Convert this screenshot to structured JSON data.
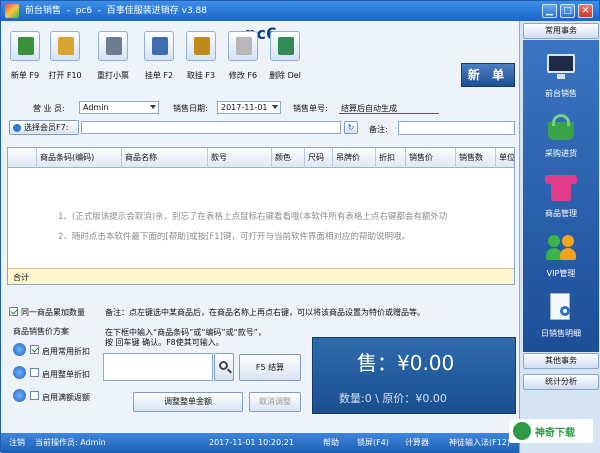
{
  "window": {
    "title": "前台销售  -  pc6  -  百事佳服装进销存 v3.88",
    "min": "▁",
    "max": "□",
    "close": "✕"
  },
  "header": {
    "store": "pc6",
    "new_bill": "新 单"
  },
  "toolbar": [
    {
      "label": "新单 F9",
      "icon": "new-bill-icon",
      "color": "#3c8f3c"
    },
    {
      "label": "打开 F10",
      "icon": "open-folder-icon",
      "color": "#d9a531"
    },
    {
      "label": "重打小票",
      "icon": "printer-icon",
      "color": "#6d7c8f"
    },
    {
      "label": "挂单 F2",
      "icon": "hang-bill-icon",
      "color": "#3e6fb3"
    },
    {
      "label": "取挂 F3",
      "icon": "lock-icon",
      "color": "#c28a1a"
    },
    {
      "label": "修改 F6",
      "icon": "edit-icon",
      "color": "#b9b9b9"
    },
    {
      "label": "删除 Del",
      "icon": "delete-icon",
      "color": "#2f8a54"
    }
  ],
  "form": {
    "salesperson_label": "营 业 员:",
    "salesperson_value": "Admin",
    "date_label": "销售日期:",
    "date_value": "2017-11-01",
    "order_no_label": "销售单号:",
    "order_no_value": "结算后自动生成",
    "member_label": "选择会员F7:",
    "member_value": "",
    "remark_label": "备注:",
    "remark_value": ""
  },
  "grid": {
    "columns": [
      "商品条码(编码)",
      "商品名称",
      "款号",
      "颜色",
      "尺码",
      "吊牌价",
      "折扣",
      "销售价",
      "销售数",
      "单位"
    ],
    "hints": [
      "1、(正式版该提示会取消)亲，别忘了在表格上点鼠标右键看看哦(本软件所有表格上点右键都会有额外功",
      "2、随时点击本软件最下面的[帮助]或按[F1]键，可打开与当前软件界面相对应的帮助说明哦。"
    ],
    "total_label": "合计"
  },
  "options": {
    "merge_label": "同一商品累加数量",
    "merge_checked": true,
    "note": "备注：点左键选中某商品后，在商品名称上再点右键，可以将该商品设置为特价或赠品等。",
    "discount_title": "商品销售价方案",
    "schemes": [
      {
        "label": "启用常用折扣",
        "checked": true
      },
      {
        "label": "启用整单折扣",
        "checked": false
      },
      {
        "label": "启用满额返额",
        "checked": false
      }
    ]
  },
  "entry": {
    "instruction_line1": "在下框中输入“商品条码”或“编码”或“款号”，",
    "instruction_line2": "按 回车键 确认。F8使其可输入。",
    "search_value": "",
    "settle_button": "F5 结算",
    "adjust_button": "调整整单金额",
    "cancel_adjust_button": "取消调整"
  },
  "summary": {
    "sale": "售：¥0.00",
    "qty_cost": "数量:0 \\ 原价：¥0.00"
  },
  "status": {
    "logout": "注销",
    "operator": "当前操作员: Admin",
    "datetime": "2017-11-01 10:20:21",
    "help": "帮助",
    "lock": "锁屏(F4)",
    "calc": "计算器",
    "ime": "神徒输入法(F12)"
  },
  "sidebar": {
    "common_title": "常用事务",
    "items": [
      {
        "label": "前台销售",
        "icon": "monitor-icon"
      },
      {
        "label": "采购进货",
        "icon": "basket-icon"
      },
      {
        "label": "商品管理",
        "icon": "shirt-icon"
      },
      {
        "label": "VIP管理",
        "icon": "members-icon"
      },
      {
        "label": "日销售明细",
        "icon": "document-search-icon"
      }
    ],
    "other_title": "其他事务",
    "stats_title": "统计分析"
  },
  "watermark": {
    "text": "神奇下载"
  }
}
